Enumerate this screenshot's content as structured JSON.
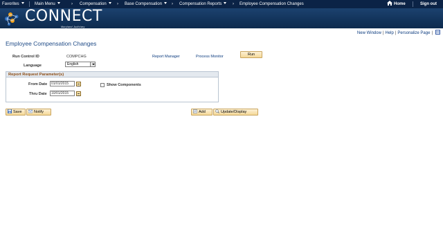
{
  "nav": {
    "favorites": "Favorites",
    "main_menu": "Main Menu",
    "compensation": "Compensation",
    "base_compensation": "Base Compensation",
    "compensation_reports": "Compensation Reports",
    "current_page": "Employee Compensation Changes",
    "home": "Home",
    "sign_out": "Sign out"
  },
  "branding": {
    "logo_text": "CONNECT",
    "logo_sub": "Maryland Judiciary"
  },
  "utility_links": {
    "new_window": "New Window",
    "help": "Help",
    "personalize_page": "Personalize Page"
  },
  "page": {
    "title": "Employee Compensation Changes"
  },
  "run_control": {
    "label": "Run Control ID",
    "value": "COMPCHG",
    "report_manager": "Report Manager",
    "process_monitor": "Process Monitor",
    "run_button": "Run"
  },
  "language": {
    "label": "Language",
    "selected": "English"
  },
  "params": {
    "header": "Report Request Parameter(s)",
    "from_date_label": "From Date",
    "from_date_value": "01/01/2015",
    "thru_date_label": "Thru Date",
    "thru_date_value": "10/01/2015",
    "show_components_label": "Show Components",
    "show_components_checked": false
  },
  "toolbar": {
    "save": "Save",
    "notify": "Notify",
    "add": "Add",
    "update_display": "Update/Display"
  },
  "colors": {
    "nav_bg": "#0b2346",
    "banner_bg": "#12335a",
    "link": "#0a3a7e",
    "title": "#1e4a86",
    "group_header_text": "#8a4a12"
  }
}
